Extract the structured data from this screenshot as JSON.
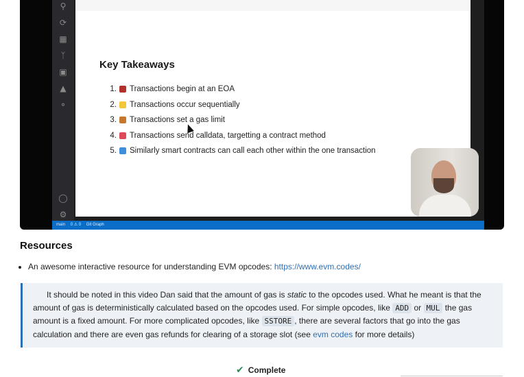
{
  "slide": {
    "title": "Key Takeaways",
    "items": [
      {
        "num": "1.",
        "text": "Transactions begin at an EOA",
        "emoji_color": "#b0322a"
      },
      {
        "num": "2.",
        "text": "Transactions occur sequentially",
        "emoji_color": "#f3c63a"
      },
      {
        "num": "3.",
        "text": "Transactions set a gas limit",
        "emoji_color": "#c7782c"
      },
      {
        "num": "4.",
        "text": "Transactions send calldata, targetting a contract method",
        "emoji_color": "#e0485a"
      },
      {
        "num": "5.",
        "text": "Similarly smart contracts can call each other within the one transaction",
        "emoji_color": "#3d8fdc"
      }
    ]
  },
  "status_bar": [
    "main",
    "0 ⚠ 0",
    "Git Graph"
  ],
  "resources": {
    "title": "Resources",
    "items": [
      {
        "text": "An awesome interactive resource for understanding EVM opcodes: ",
        "link": "https://www.evm.codes/"
      }
    ]
  },
  "note": {
    "p1": "It should be noted in this video Dan said that the amount of gas is ",
    "static": "static",
    "p2": " to the opcodes used. What he meant is that the amount of gas is deterministically calculated based on the opcodes used. For simple opcodes, like ",
    "code_add": "ADD",
    "or": " or ",
    "code_mul": "MUL",
    "p3": " the gas amount is a fixed amount. For more complicated opcodes, like ",
    "code_sstore": "SSTORE",
    "p4": ", there are several factors that go into the gas calculation and there are even gas refunds for clearing of a storage slot (see ",
    "link": "evm codes",
    "p5": " for more details)"
  },
  "complete_label": "Complete",
  "colors": {
    "accent": "#2f6fb5",
    "note_bg": "#eef2f6",
    "check": "#2e8b57",
    "vscode_status": "#0a6ec9"
  },
  "icons": [
    "search-icon",
    "source-control-icon",
    "extensions-icon",
    "git-graph-icon",
    "remote-icon",
    "docker-icon",
    "account-icon",
    "settings-icon",
    "check-icon"
  ]
}
